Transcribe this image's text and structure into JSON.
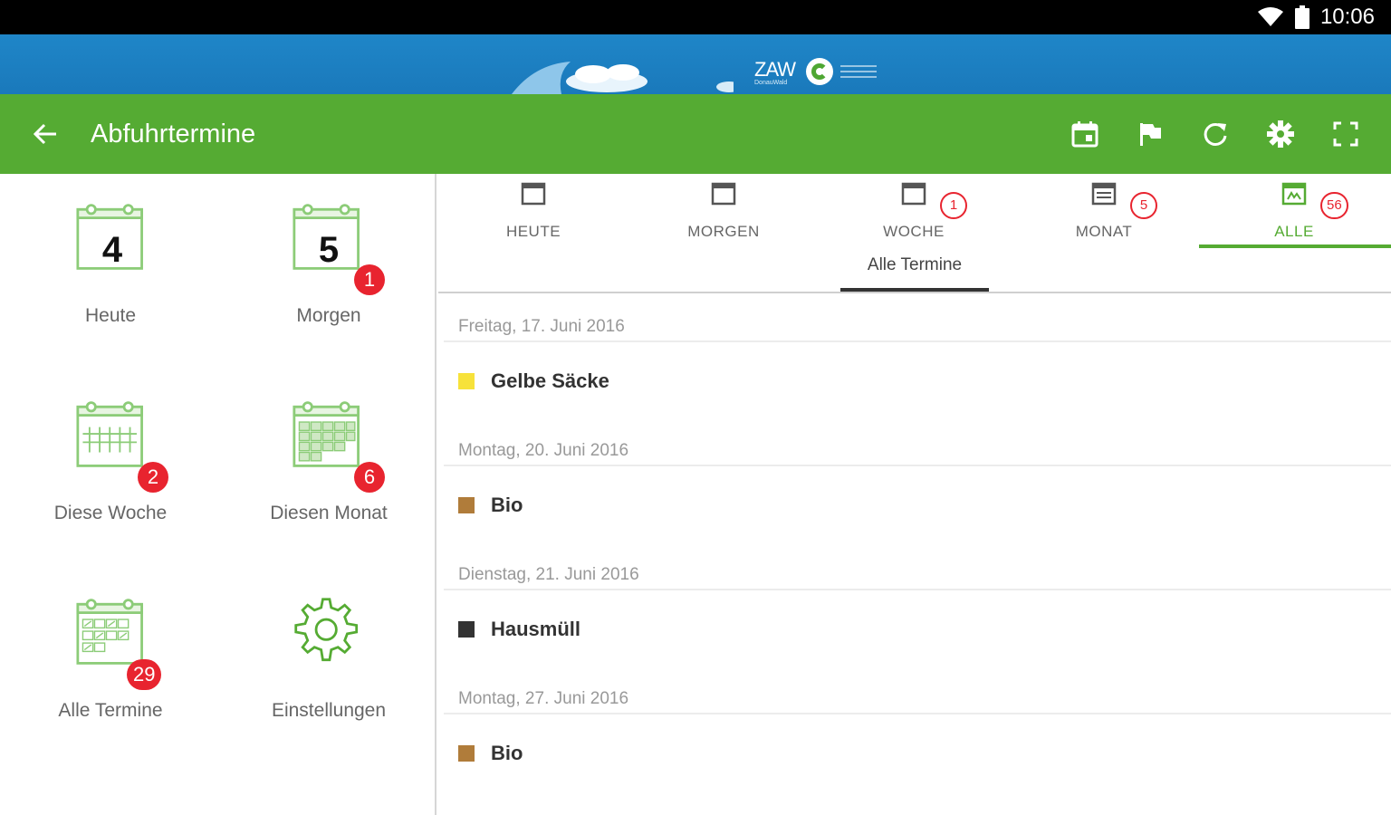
{
  "status_bar": {
    "time": "10:06",
    "wifi_icon": "wifi-icon",
    "battery_icon": "battery-icon"
  },
  "banner": {
    "logo_text": "ZAW",
    "logo_sub": "DonauWald"
  },
  "toolbar": {
    "title": "Abfuhrtermine",
    "actions": [
      "calendar-icon",
      "flag-icon",
      "refresh-icon",
      "settings-icon",
      "fullscreen-icon"
    ]
  },
  "left_menu": {
    "tiles": [
      {
        "label": "Heute",
        "day": "4",
        "badge": ""
      },
      {
        "label": "Morgen",
        "day": "5",
        "badge": "1"
      },
      {
        "label": "Diese Woche",
        "badge": "2"
      },
      {
        "label": "Diesen Monat",
        "badge": "6"
      },
      {
        "label": "Alle Termine",
        "badge": "29"
      },
      {
        "label": "Einstellungen",
        "badge": ""
      }
    ]
  },
  "tabs": [
    {
      "label": "HEUTE",
      "badge": ""
    },
    {
      "label": "MORGEN",
      "badge": ""
    },
    {
      "label": "WOCHE",
      "badge": "1"
    },
    {
      "label": "MONAT",
      "badge": "5"
    },
    {
      "label": "ALLE",
      "badge": "56",
      "active": true
    }
  ],
  "subtab": {
    "label": "Alle Termine"
  },
  "entries": [
    {
      "date": "Freitag, 17. Juni 2016",
      "name": "Gelbe Säcke",
      "color": "#f7e23a"
    },
    {
      "date": "Montag, 20. Juni 2016",
      "name": "Bio",
      "color": "#b07c3a"
    },
    {
      "date": "Dienstag, 21. Juni 2016",
      "name": "Hausmüll",
      "color": "#333333"
    },
    {
      "date": "Montag, 27. Juni 2016",
      "name": "Bio",
      "color": "#b07c3a"
    }
  ],
  "colors": {
    "green": "#55ab33",
    "blue": "#1f86c8",
    "badge_red": "#e8242f"
  }
}
